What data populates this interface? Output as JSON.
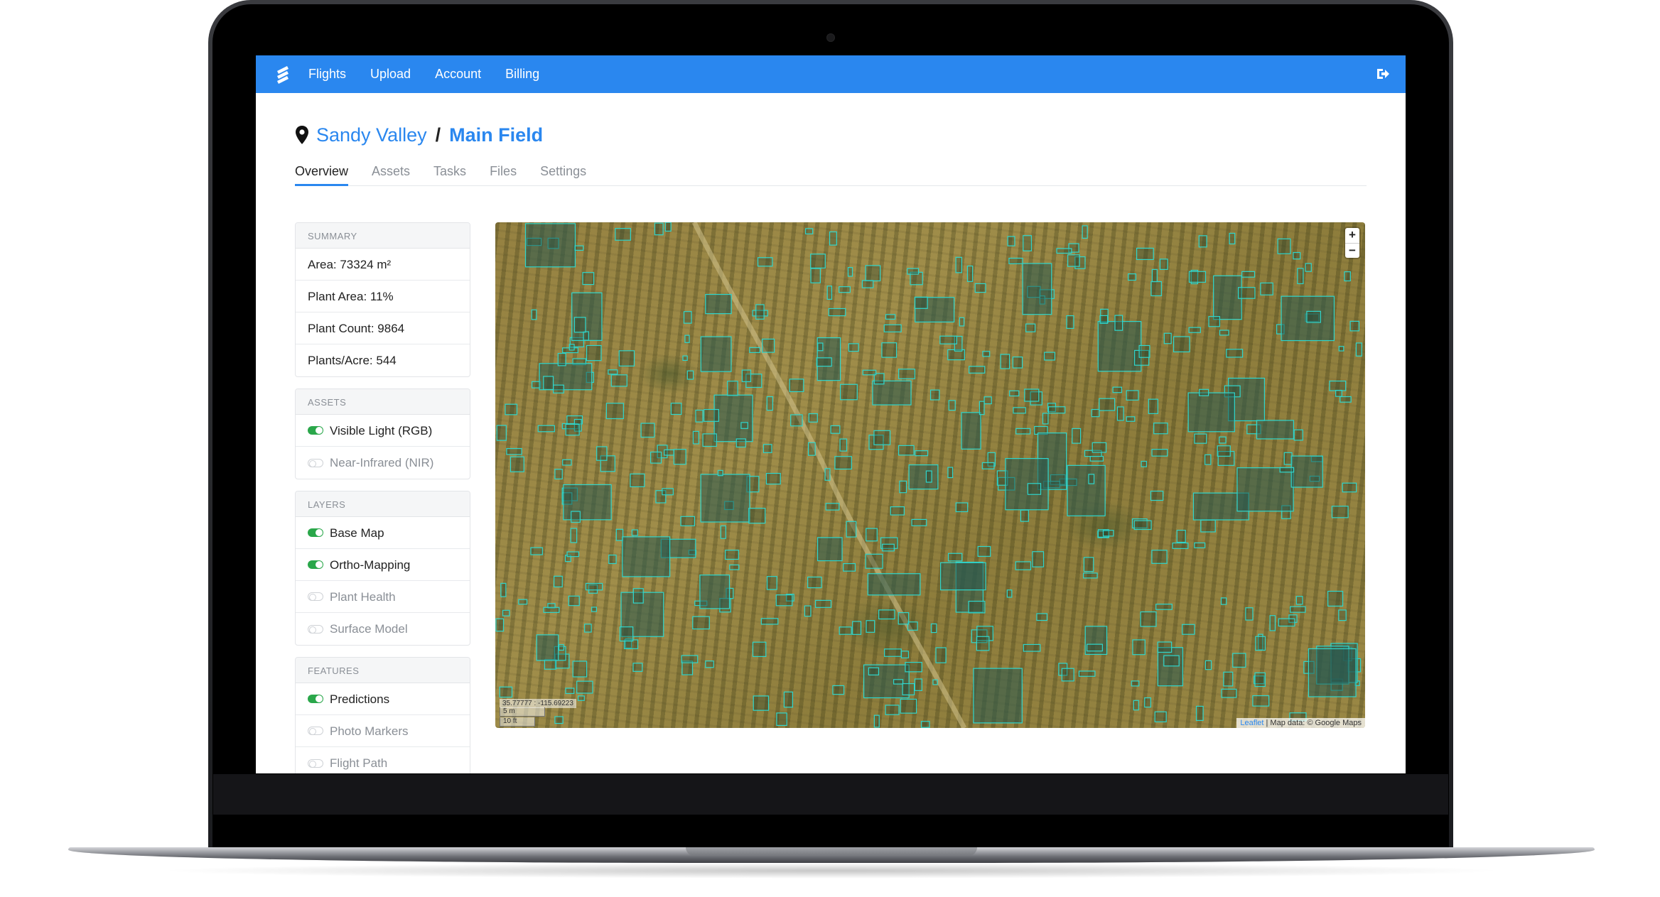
{
  "nav": {
    "links": [
      "Flights",
      "Upload",
      "Account",
      "Billing"
    ]
  },
  "breadcrumb": {
    "parent": "Sandy Valley",
    "separator": "/",
    "current": "Main Field"
  },
  "tabs": [
    "Overview",
    "Assets",
    "Tasks",
    "Files",
    "Settings"
  ],
  "active_tab": "Overview",
  "summary": {
    "title": "SUMMARY",
    "rows": [
      "Area: 73324 m²",
      "Plant Area: 11%",
      "Plant Count: 9864",
      "Plants/Acre: 544"
    ]
  },
  "assets": {
    "title": "ASSETS",
    "items": [
      {
        "label": "Visible Light (RGB)",
        "on": true
      },
      {
        "label": "Near-Infrared (NIR)",
        "on": false
      }
    ]
  },
  "layers": {
    "title": "LAYERS",
    "items": [
      {
        "label": "Base Map",
        "on": true
      },
      {
        "label": "Ortho-Mapping",
        "on": true
      },
      {
        "label": "Plant Health",
        "on": false
      },
      {
        "label": "Surface Model",
        "on": false
      }
    ]
  },
  "features": {
    "title": "FEATURES",
    "items": [
      {
        "label": "Predictions",
        "on": true
      },
      {
        "label": "Photo Markers",
        "on": false
      },
      {
        "label": "Flight Path",
        "on": false
      }
    ]
  },
  "map": {
    "zoom_in": "+",
    "zoom_out": "−",
    "coordinates": "35.77777 : -115.69223",
    "scale_metric": "5 m",
    "scale_imperial": "10 ft",
    "attribution_link": "Leaflet",
    "attribution_text": " | Map data: © Google Maps",
    "box_color": "#2fd6cc"
  },
  "colors": {
    "navbar": "#2a87ef",
    "accent": "#2a87ef",
    "toggle_on": "#2aa74a"
  },
  "icons": {
    "logo": "lightning-logo-icon",
    "logout": "logout-icon",
    "location": "map-pin-icon"
  }
}
